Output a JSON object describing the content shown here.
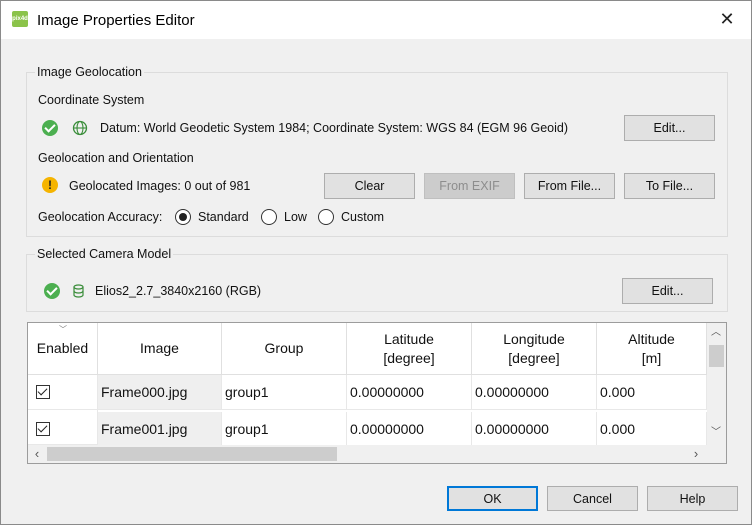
{
  "window": {
    "title": "Image Properties Editor",
    "app_icon_text": "pix4d"
  },
  "geolocation": {
    "group_title": "Image Geolocation",
    "coord_system_label": "Coordinate System",
    "datum_text": "Datum: World Geodetic System 1984; Coordinate System: WGS 84 (EGM 96 Geoid)",
    "edit_label": "Edit...",
    "geo_orient_label": "Geolocation and Orientation",
    "geolocated_text": "Geolocated Images: 0 out of 981",
    "buttons": {
      "clear": "Clear",
      "from_exif": "From EXIF",
      "from_file": "From File...",
      "to_file": "To File..."
    },
    "accuracy_label": "Geolocation Accuracy:",
    "accuracy_options": [
      "Standard",
      "Low",
      "Custom"
    ],
    "accuracy_selected": "Standard"
  },
  "camera": {
    "group_title": "Selected Camera Model",
    "model_text": "Elios2_2.7_3840x2160 (RGB)",
    "edit_label": "Edit..."
  },
  "table": {
    "headers": {
      "enabled": "Enabled",
      "image": "Image",
      "group": "Group",
      "latitude": "Latitude\n[degree]",
      "longitude": "Longitude\n[degree]",
      "altitude": "Altitude\n[m]"
    },
    "rows": [
      {
        "enabled": true,
        "image": "Frame000.jpg",
        "group": "group1",
        "latitude": "0.00000000",
        "longitude": "0.00000000",
        "altitude": "0.000"
      },
      {
        "enabled": true,
        "image": "Frame001.jpg",
        "group": "group1",
        "latitude": "0.00000000",
        "longitude": "0.00000000",
        "altitude": "0.000"
      }
    ]
  },
  "footer": {
    "ok": "OK",
    "cancel": "Cancel",
    "help": "Help"
  },
  "icons": {
    "close": "close-icon",
    "status_ok": "check-circle-icon",
    "globe": "globe-icon",
    "warning": "warning-icon",
    "camera_db": "database-icon"
  },
  "colors": {
    "ok_green": "#4caf50",
    "warning_yellow": "#f5b400",
    "default_button_border": "#0078d7"
  }
}
